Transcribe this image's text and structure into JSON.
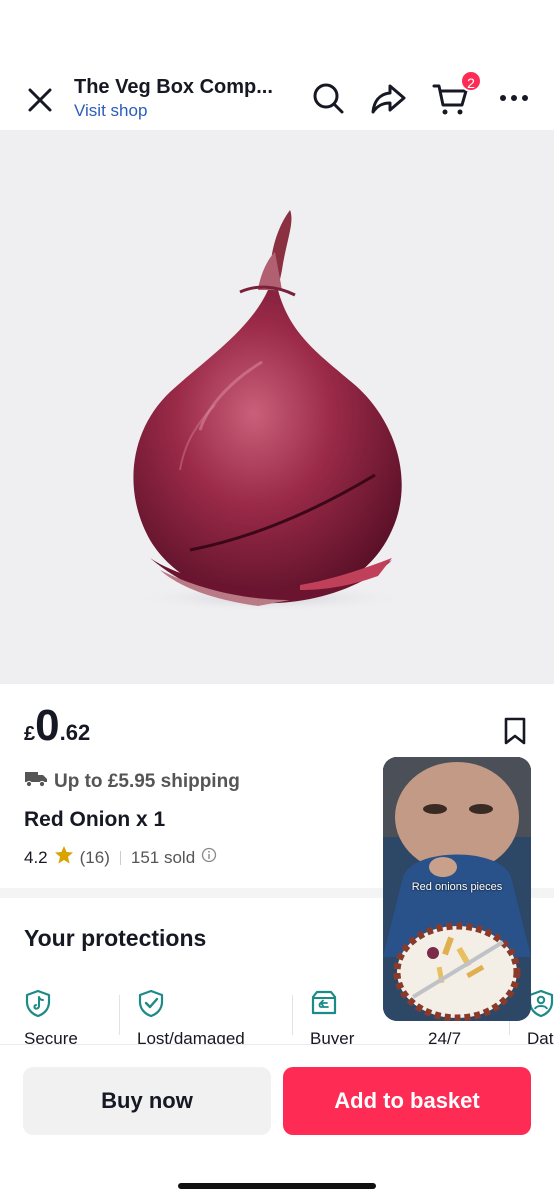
{
  "header": {
    "shop_name": "The Veg Box Comp...",
    "visit_shop": "Visit shop",
    "cart_count": "2"
  },
  "product": {
    "price_currency": "£",
    "price_int": "0",
    "price_dec": ".62",
    "shipping": "Up to £5.95 shipping",
    "title": "Red Onion x 1",
    "rating": "4.2",
    "review_count": "(16)",
    "sold": "151 sold"
  },
  "protections": {
    "title": "Your protections",
    "items": [
      {
        "label": "Secure",
        "icon": "shield-tiktok-icon"
      },
      {
        "label": "Lost/damaged",
        "icon": "shield-check-icon"
      },
      {
        "label": "Buyer",
        "icon": "return-box-icon"
      },
      {
        "label": "24/7",
        "icon": "support-icon"
      },
      {
        "label": "Dat",
        "icon": "data-privacy-icon"
      }
    ]
  },
  "video": {
    "caption": "Red onions pieces"
  },
  "actions": {
    "buy_now": "Buy now",
    "add_to_basket": "Add to basket"
  },
  "colors": {
    "accent": "#fe2c55",
    "link": "#2b5db9",
    "protection_icon": "#1c8a86",
    "star": "#f5b400"
  }
}
